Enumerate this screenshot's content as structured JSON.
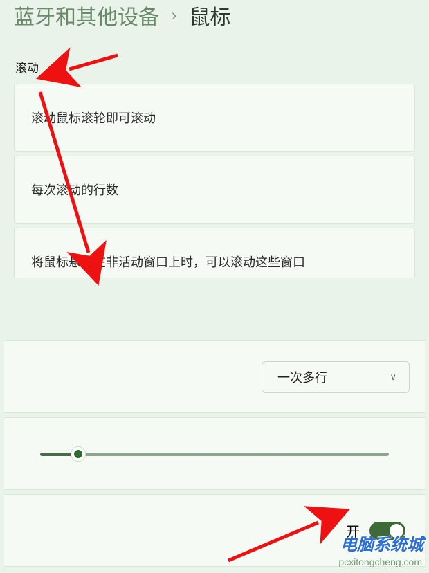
{
  "breadcrumb": {
    "parent": "蓝牙和其他设备",
    "current": "鼠标"
  },
  "section_label": "滚动",
  "cards": {
    "scroll_wheel": "滚动鼠标滚轮即可滚动",
    "lines_per_scroll": "每次滚动的行数",
    "hover_inactive": "将鼠标悬停在非活动窗口上时，可以滚动这些窗口"
  },
  "dropdown": {
    "value": "一次多行"
  },
  "slider": {
    "percent": 11
  },
  "toggle": {
    "label": "开",
    "state": true
  },
  "watermark": {
    "brand": "电脑系统城",
    "url": "pcxitongcheng.com"
  }
}
